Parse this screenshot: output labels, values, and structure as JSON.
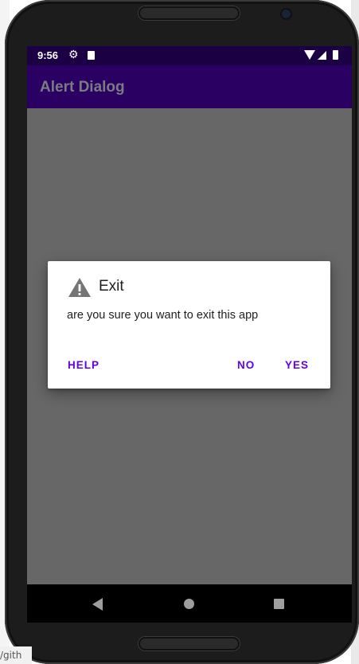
{
  "desktop": {
    "url_fragment": "/gith"
  },
  "status_bar": {
    "time": "9:56",
    "icons": [
      "gear-icon",
      "sd-card-icon",
      "wifi-icon",
      "signal-icon",
      "battery-icon"
    ]
  },
  "app_bar": {
    "title": "Alert Dialog"
  },
  "dialog": {
    "icon": "warning-icon",
    "title": "Exit",
    "message": "are you sure you want to exit this app",
    "buttons": {
      "neutral": "HELP",
      "negative": "NO",
      "positive": "YES"
    }
  },
  "nav_bar": {
    "icons": [
      "back-icon",
      "home-icon",
      "recents-icon"
    ]
  },
  "colors": {
    "status_bar": "#1b0044",
    "app_bar": "#2a0063",
    "scrim": "#676767",
    "accent": "#6200ee"
  }
}
